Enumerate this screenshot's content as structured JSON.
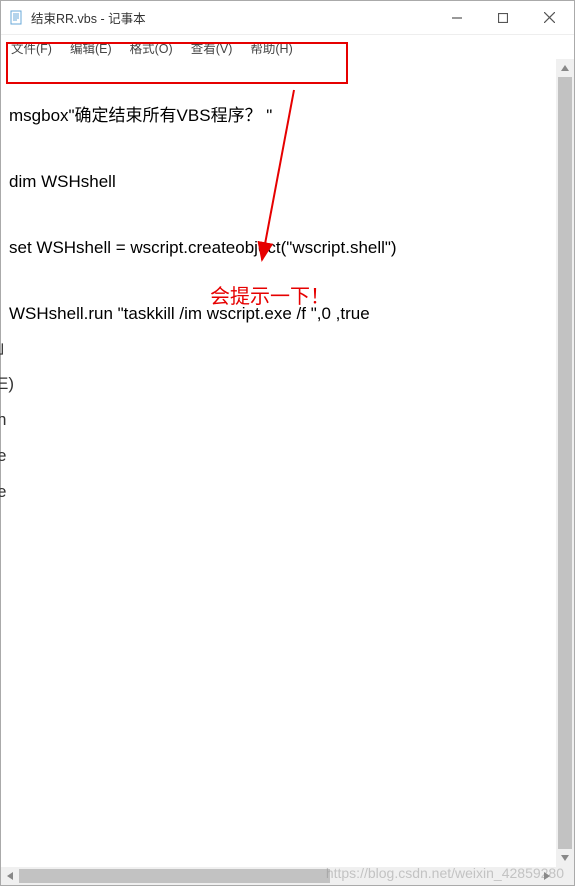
{
  "titlebar": {
    "title": "结束RR.vbs - 记事本"
  },
  "win_controls": {
    "minimize": "—",
    "maximize": "☐",
    "close": "✕"
  },
  "menubar": {
    "items": [
      {
        "label": "文件(F)"
      },
      {
        "label": "编辑(E)"
      },
      {
        "label": "格式(O)"
      },
      {
        "label": "查看(V)"
      },
      {
        "label": "帮助(H)"
      }
    ]
  },
  "code": {
    "lines": [
      "msgbox\"确定结束所有VBS程序？ \"",
      "dim WSHshell",
      "set WSHshell = wscript.createobject(\"wscript.shell\")",
      "WSHshell.run \"taskkill /im wscript.exe /f \",0 ,true"
    ]
  },
  "annotation": {
    "text": "会提示一下！"
  },
  "watermark": {
    "text": "https://blog.csdn.net/weixin_42859280"
  },
  "left_fragments": {
    "l1": "」",
    "l2": " ",
    "l3": "E)",
    "l4": " ",
    "l5": "n",
    "l6": "e",
    "l7": "e"
  }
}
